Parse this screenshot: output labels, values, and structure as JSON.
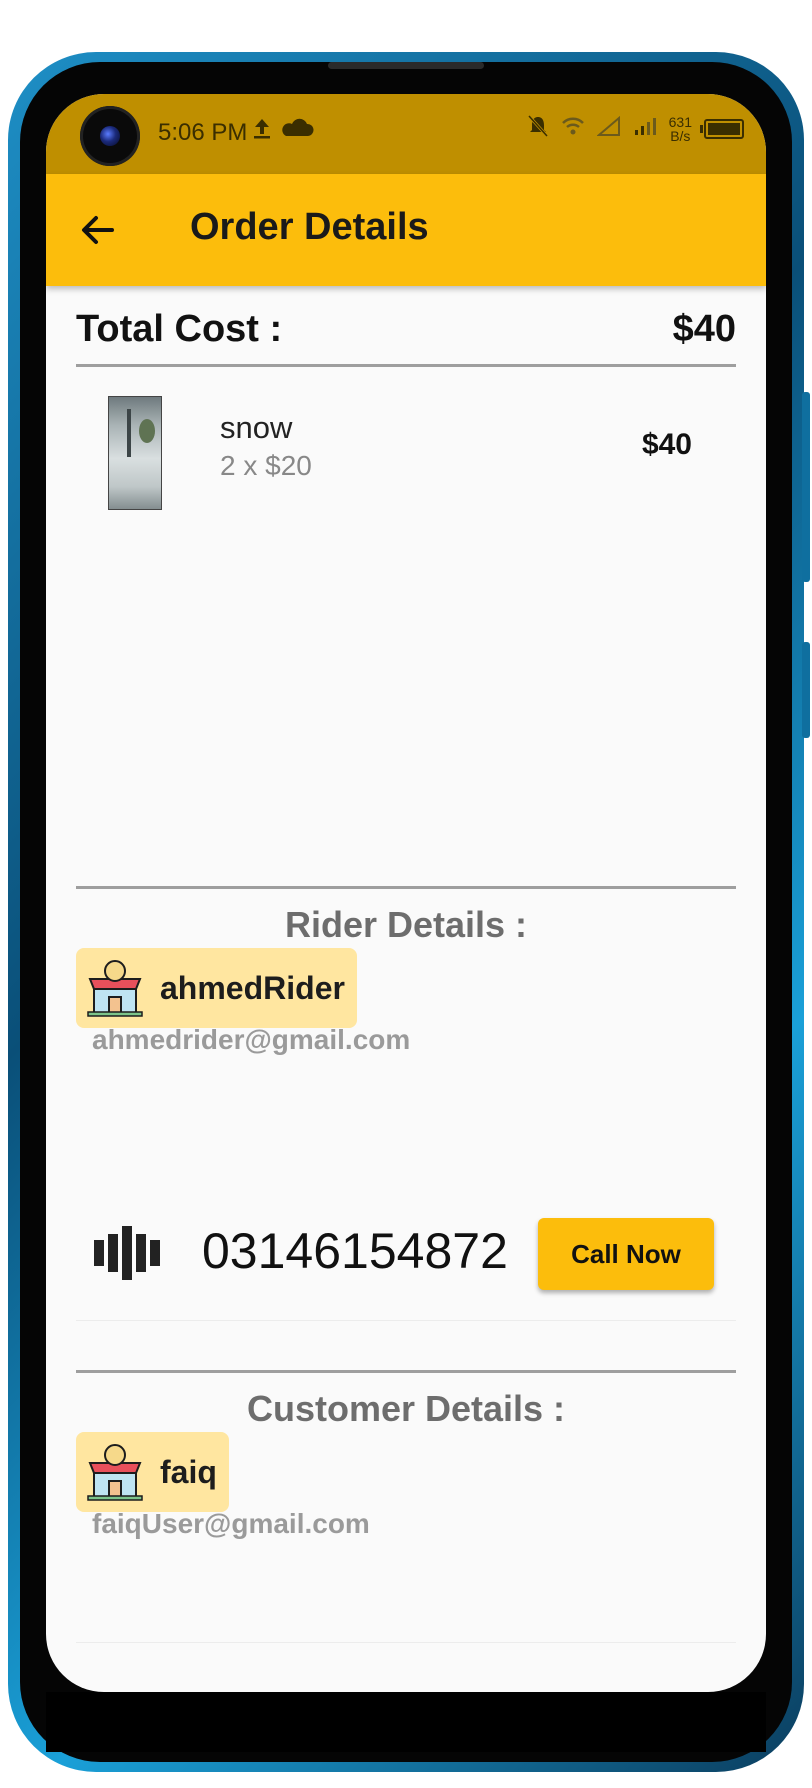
{
  "status_bar": {
    "time": "5:06 PM",
    "net_speed_value": "631",
    "net_speed_unit": "B/s"
  },
  "app_bar": {
    "title": "Order Details"
  },
  "summary": {
    "total_label": "Total Cost :",
    "total_value": "$40"
  },
  "items": [
    {
      "name": "snow",
      "quantity_line": "2 x $20",
      "line_total": "$40"
    }
  ],
  "rider": {
    "section_title": "Rider Details :",
    "name": "ahmedRider",
    "email": "ahmedrider@gmail.com",
    "phone": "03146154872",
    "call_label": "Call Now"
  },
  "customer": {
    "section_title": "Customer Details :",
    "name": "faiq",
    "email": "faiqUser@gmail.com"
  },
  "colors": {
    "status_bar": "#bf8f00",
    "app_bar": "#fcbd0c",
    "chip_bg": "#ffe6a0",
    "background": "#fafafa"
  }
}
